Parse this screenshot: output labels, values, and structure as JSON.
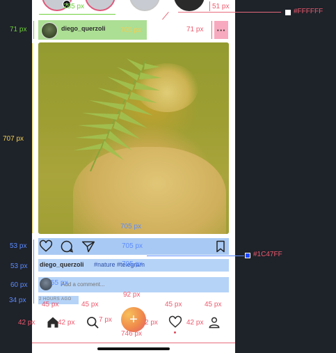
{
  "status": {
    "plus_glyph": "+"
  },
  "post": {
    "username": "diego_querzoli",
    "more_glyph": "···",
    "caption_user": "diego_querzoli",
    "caption_tags": "#nature #telegram",
    "comment_placeholder": "Add a comment...",
    "time_ago": "2 HOURS AGO"
  },
  "tabbar": {
    "add_glyph": "+"
  },
  "annotations": {
    "colors": {
      "white_label": "#FFFFFF",
      "blue_label": "#1C47FF",
      "white_swatch": "#FFFFFF",
      "blue_swatch": "#1C47FF"
    },
    "story_width": "285 px",
    "top_right_height": "51 px",
    "header_height": "71 px",
    "header_width": "705 px",
    "more_height": "71 px",
    "photo_height": "707 px",
    "photo_width": "705 px",
    "actions_height": "53 px",
    "actions_width": "705 px",
    "caption_height": "53 px",
    "caption_width": "705 px",
    "comment_height": "60 px",
    "comment_avatar": "55 px",
    "time_height": "34 px",
    "tab_home_w": "45 px",
    "tab_search_w": "45 px",
    "tab_add_w": "92 px",
    "tab_heart_w": "45 px",
    "tab_profile_w": "45 px",
    "tab_height_left": "42 px",
    "tab_height_home": "42 px",
    "tab_gap_left": "7 px",
    "tab_gap_right": "2 px",
    "tab_height_right": "42 px",
    "tabbar_width": "746 px"
  }
}
